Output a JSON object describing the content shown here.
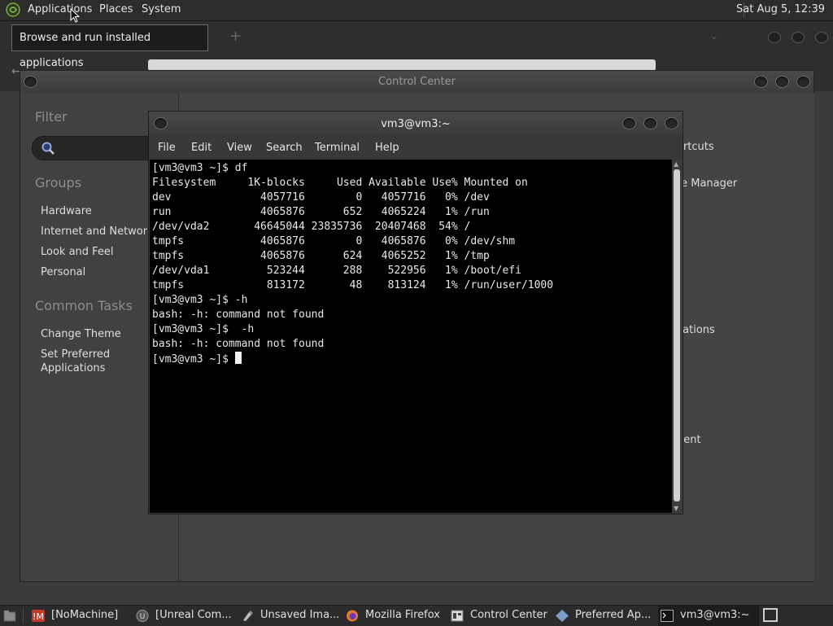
{
  "top_panel": {
    "menus": [
      "Applications",
      "Places",
      "System"
    ],
    "clock": "Sat Aug  5, 12:39"
  },
  "tooltip": {
    "text": "Browse and run installed applications"
  },
  "control_center": {
    "title": "Control Center",
    "filter_heading": "Filter",
    "groups_heading": "Groups",
    "groups": [
      "Hardware",
      "Internet and Network",
      "Look and Feel",
      "Personal"
    ],
    "common_tasks_heading": "Common Tasks",
    "common_tasks": [
      "Change Theme",
      "Set Preferred Applications"
    ],
    "partial_items": [
      "ortcuts",
      "te Manager",
      "cations",
      "nent"
    ]
  },
  "terminal": {
    "title": "vm3@vm3:~",
    "menus": [
      "File",
      "Edit",
      "View",
      "Search",
      "Terminal",
      "Help"
    ],
    "lines": [
      "[vm3@vm3 ~]$ df",
      "Filesystem     1K-blocks     Used Available Use% Mounted on",
      "dev              4057716        0   4057716   0% /dev",
      "run              4065876      652   4065224   1% /run",
      "/dev/vda2       46645044 23835736  20407468  54% /",
      "tmpfs            4065876        0   4065876   0% /dev/shm",
      "tmpfs            4065876      624   4065252   1% /tmp",
      "/dev/vda1         523244      288    522956   1% /boot/efi",
      "tmpfs             813172       48    813124   1% /run/user/1000",
      "[vm3@vm3 ~]$ -h",
      "bash: -h: command not found",
      "[vm3@vm3 ~]$  -h",
      "bash: -h: command not found"
    ],
    "prompt": "[vm3@vm3 ~]$ "
  },
  "taskbar": {
    "items": [
      {
        "label": "[NoMachine]",
        "icon": "nomachine-icon"
      },
      {
        "label": "[Unreal Com...",
        "icon": "unreal-icon"
      },
      {
        "label": "Unsaved Ima...",
        "icon": "image-editor-icon"
      },
      {
        "label": "Mozilla Firefox",
        "icon": "firefox-icon"
      },
      {
        "label": "Control Center",
        "icon": "control-center-icon"
      },
      {
        "label": "Preferred Ap...",
        "icon": "preferred-apps-icon"
      },
      {
        "label": "vm3@vm3:~",
        "icon": "terminal-icon"
      }
    ]
  },
  "colors": {
    "panel_bg": "#2c2c2c",
    "window_bg": "#3e3e3e",
    "terminal_bg": "#000000",
    "terminal_fg": "#e8e8e8",
    "heading": "#8d8d8d"
  }
}
